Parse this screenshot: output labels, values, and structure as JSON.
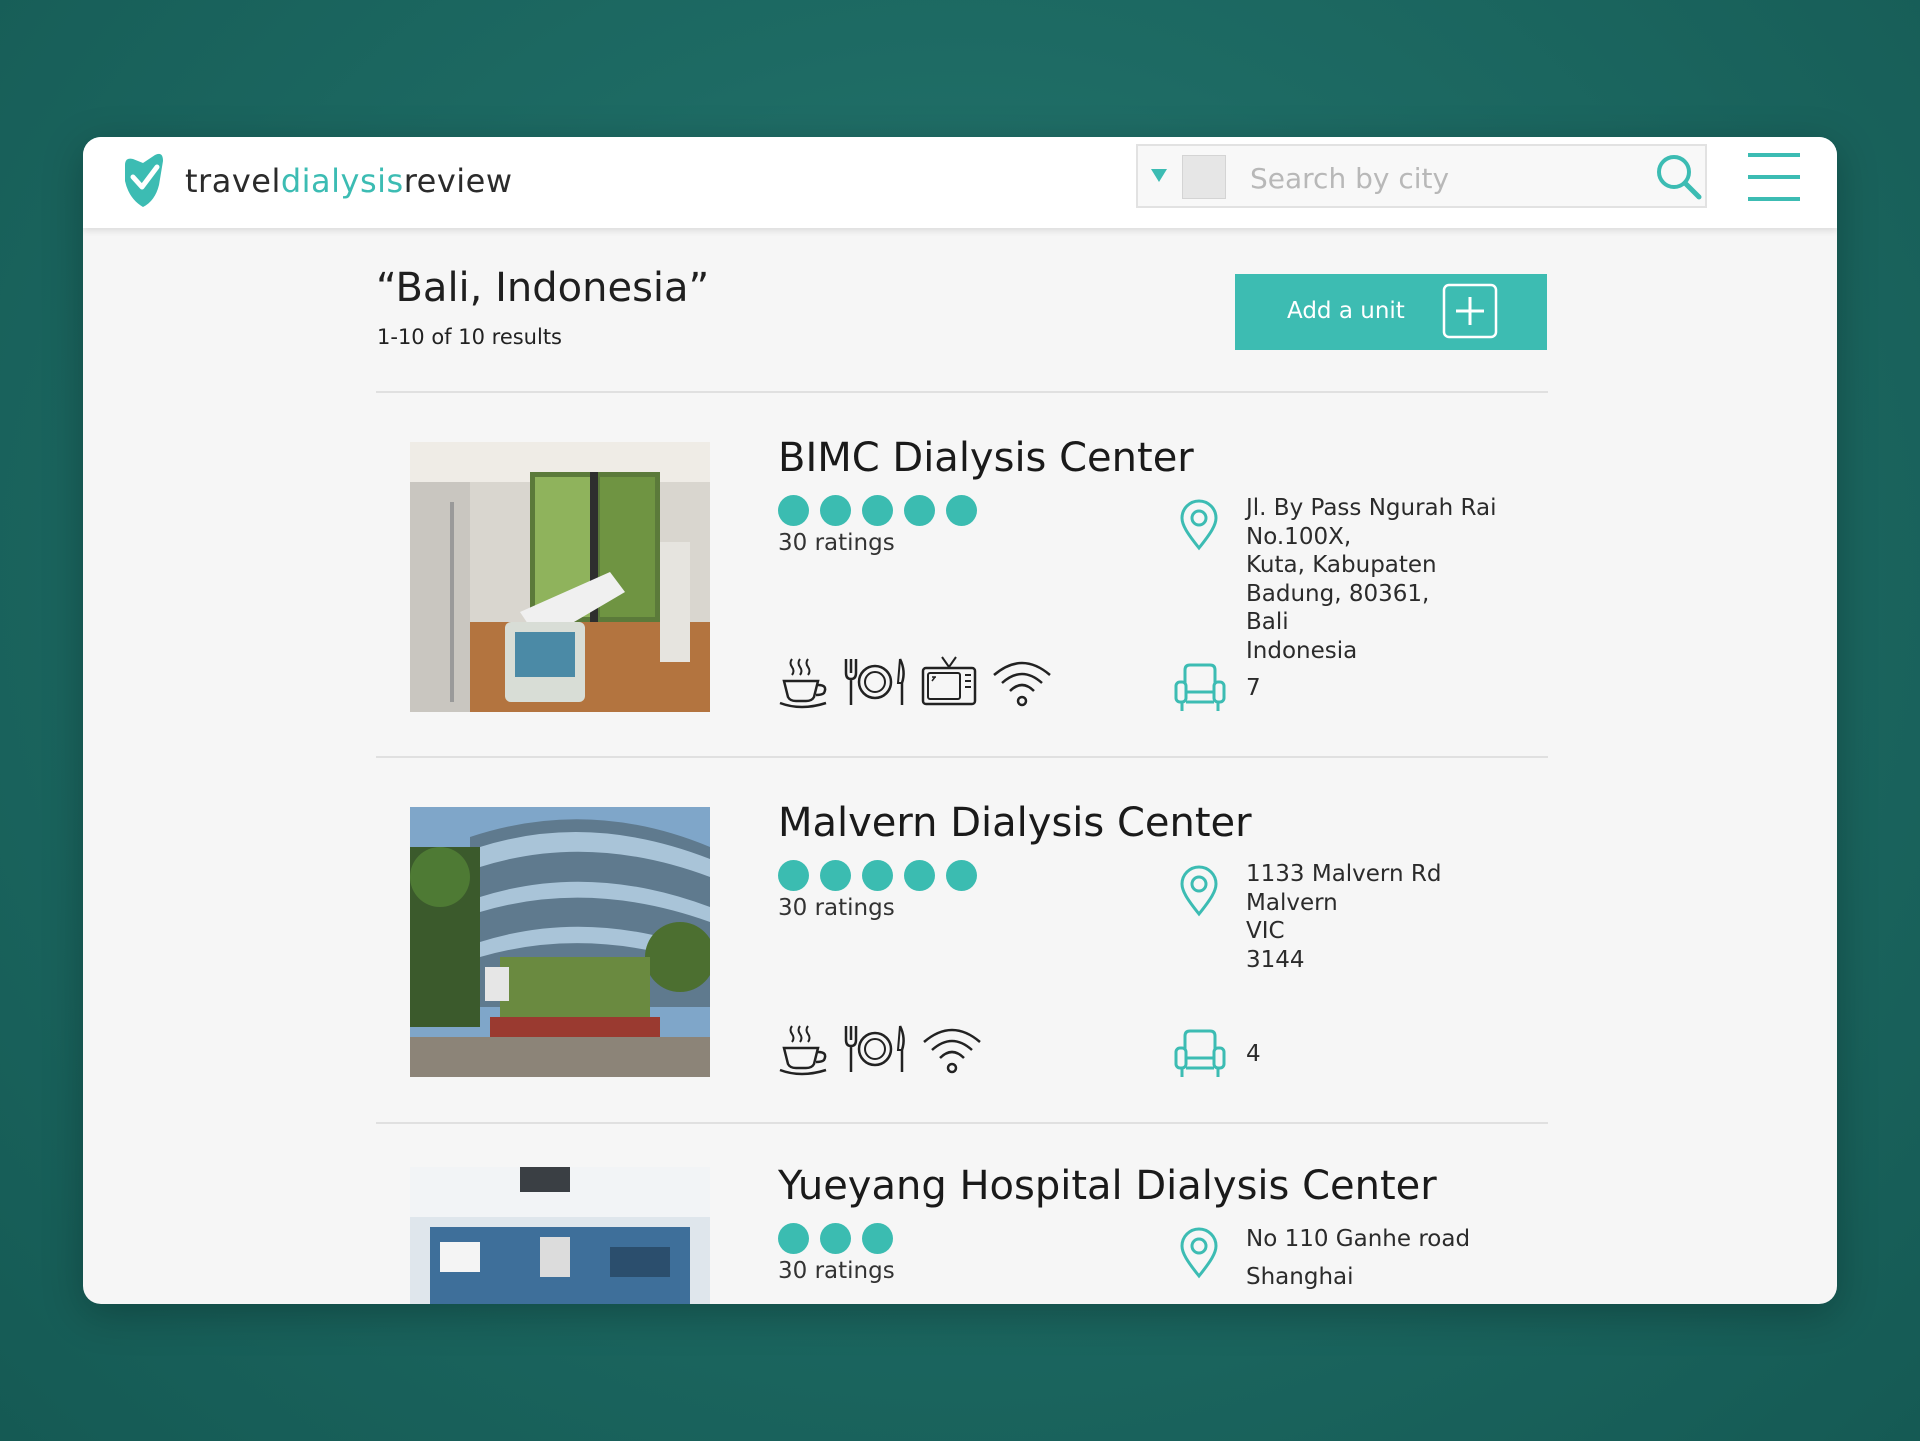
{
  "brand": {
    "part1": "travel",
    "part2": "dialysis",
    "part3": "review"
  },
  "search": {
    "placeholder": "Search by city"
  },
  "header": {
    "title": "“Bali, Indonesia”",
    "count": "1-10 of 10 results",
    "add_button": "Add a unit"
  },
  "colors": {
    "accent": "#3dbcb2",
    "background": "#1d6a63",
    "panel": "#f6f6f6"
  },
  "listings": [
    {
      "name": "BIMC Dialysis Center",
      "rating": 5,
      "ratings_label": "30 ratings",
      "address_lines": [
        "Jl. By Pass Ngurah Rai",
        "No.100X,",
        "Kuta, Kabupaten",
        "Badung, 80361,",
        "Bali",
        "Indonesia"
      ],
      "amenities": [
        "coffee-icon",
        "meal-icon",
        "tv-icon",
        "wifi-icon"
      ],
      "chairs": "7"
    },
    {
      "name": "Malvern Dialysis Center",
      "rating": 5,
      "ratings_label": "30 ratings",
      "address_lines": [
        "1133 Malvern Rd",
        "Malvern",
        "VIC",
        "3144"
      ],
      "amenities": [
        "coffee-icon",
        "meal-icon",
        "wifi-icon"
      ],
      "chairs": "4"
    },
    {
      "name": "Yueyang Hospital Dialysis Center",
      "rating": 3,
      "ratings_label": "30 ratings",
      "address_lines": [
        "No 110 Ganhe road",
        "Shanghai"
      ]
    }
  ]
}
